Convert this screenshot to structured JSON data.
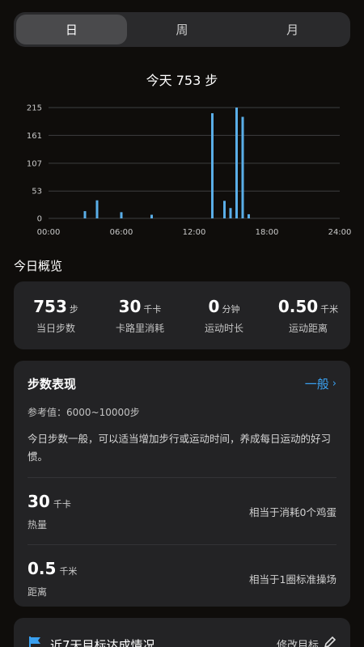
{
  "tabs": [
    {
      "label": "日",
      "active": true
    },
    {
      "label": "周",
      "active": false
    },
    {
      "label": "月",
      "active": false
    }
  ],
  "chart_title": "今天 753 步",
  "chart_data": {
    "type": "bar",
    "title": "今天 753 步",
    "xlabel": "",
    "ylabel": "",
    "x_range": [
      0,
      24
    ],
    "x_ticks": [
      {
        "value": 0,
        "label": "00:00"
      },
      {
        "value": 6,
        "label": "06:00"
      },
      {
        "value": 12,
        "label": "12:00"
      },
      {
        "value": 18,
        "label": "18:00"
      },
      {
        "value": 24,
        "label": "24:00"
      }
    ],
    "ylim": [
      0,
      215
    ],
    "y_ticks": [
      0,
      53,
      107,
      161,
      215
    ],
    "grid": true,
    "bar_color": "#5aaee8",
    "bars": [
      {
        "t": 3.0,
        "value": 14
      },
      {
        "t": 4.0,
        "value": 35
      },
      {
        "t": 6.0,
        "value": 12
      },
      {
        "t": 8.5,
        "value": 7
      },
      {
        "t": 13.5,
        "value": 204
      },
      {
        "t": 14.5,
        "value": 34
      },
      {
        "t": 15.0,
        "value": 20
      },
      {
        "t": 15.5,
        "value": 215
      },
      {
        "t": 16.0,
        "value": 197
      },
      {
        "t": 16.5,
        "value": 8
      }
    ]
  },
  "overview": {
    "title": "今日概览",
    "stats": [
      {
        "value": "753",
        "unit": "步",
        "label": "当日步数"
      },
      {
        "value": "30",
        "unit": "千卡",
        "label": "卡路里消耗"
      },
      {
        "value": "0",
        "unit": "分钟",
        "label": "运动时长"
      },
      {
        "value": "0.50",
        "unit": "千米",
        "label": "运动距离"
      }
    ]
  },
  "performance": {
    "title": "步数表现",
    "level": "一般",
    "reference": "参考值：6000~10000步",
    "description": "今日步数一般，可以适当增加步行或运动时间，养成每日运动的好习惯。",
    "metrics": [
      {
        "value": "30",
        "unit": "千卡",
        "label": "热量",
        "note": "相当于消耗0个鸡蛋"
      },
      {
        "value": "0.5",
        "unit": "千米",
        "label": "距离",
        "note": "相当于1圈标准操场"
      }
    ]
  },
  "goal": {
    "title": "近7天目标达成情况",
    "edit_label": "修改目标",
    "icon": "flag-icon",
    "edit_icon": "pencil-icon",
    "flag_color": "#3aa0f0"
  }
}
